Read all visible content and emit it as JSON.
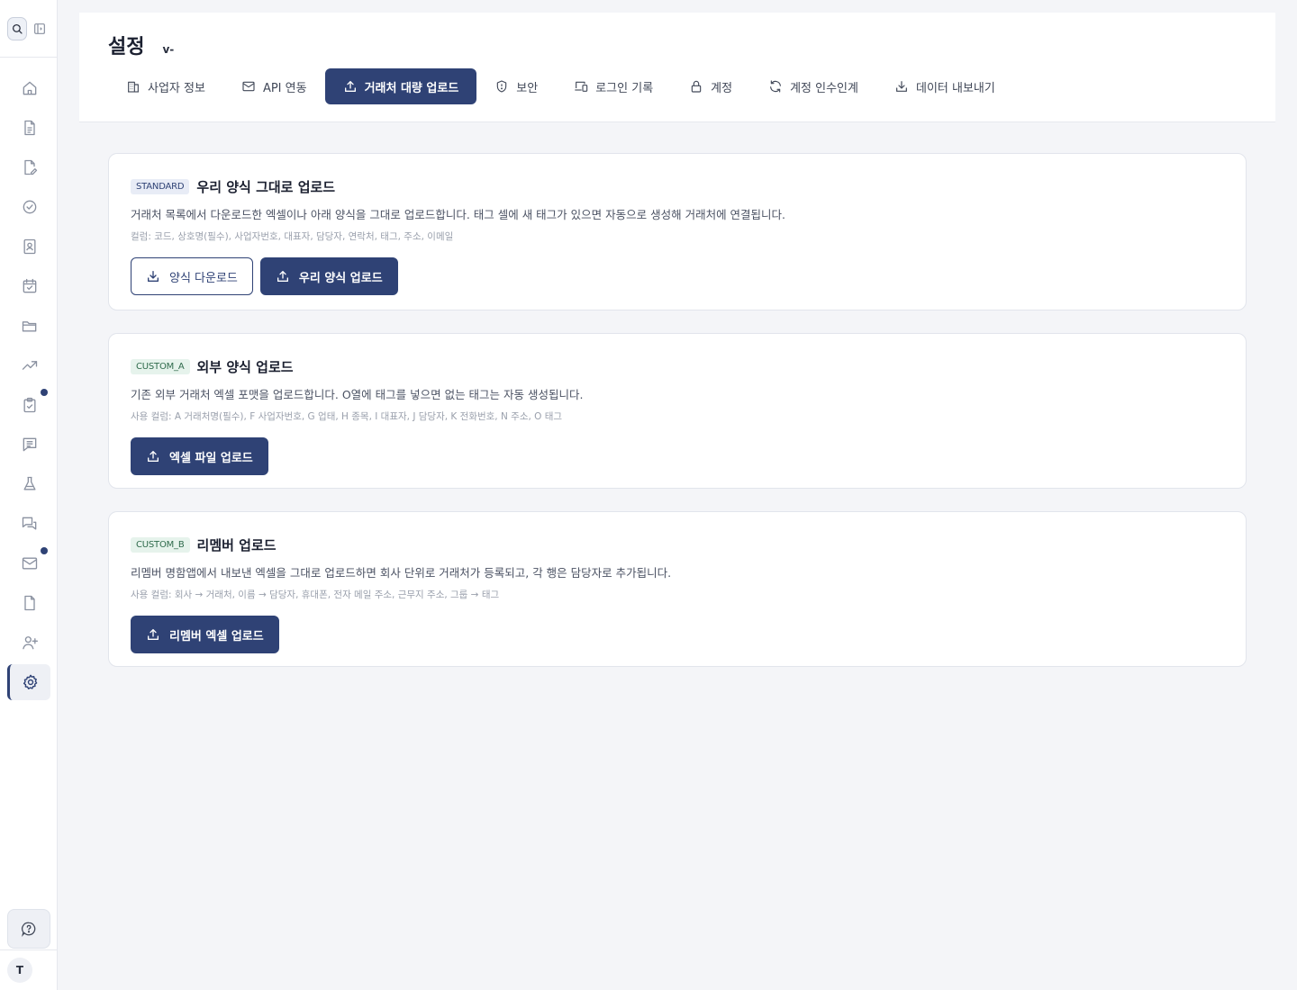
{
  "header": {
    "title": "설정",
    "version": "v-"
  },
  "tabs": [
    {
      "label": "사업자 정보",
      "icon": "building-icon"
    },
    {
      "label": "API 연동",
      "icon": "mail-icon"
    },
    {
      "label": "거래처 대량 업로드",
      "icon": "upload-icon",
      "active": true
    },
    {
      "label": "보안",
      "icon": "shield-icon"
    },
    {
      "label": "로그인 기록",
      "icon": "devices-icon"
    },
    {
      "label": "계정",
      "icon": "lock-icon"
    },
    {
      "label": "계정 인수인계",
      "icon": "refresh-icon"
    },
    {
      "label": "데이터 내보내기",
      "icon": "download-icon"
    }
  ],
  "cards": [
    {
      "badge": "STANDARD",
      "title": "우리 양식 그대로 업로드",
      "description": "거래처 목록에서 다운로드한 엑셀이나 아래 양식을 그대로 업로드합니다. 태그 셀에 새 태그가 있으면 자동으로 생성해 거래처에 연결됩니다.",
      "columns": "컬럼: 코드, 상호명(필수), 사업자번호, 대표자, 담당자, 연락처, 태그, 주소, 이메일",
      "buttons": [
        "양식 다운로드",
        "우리 양식 업로드"
      ]
    },
    {
      "badge": "CUSTOM_A",
      "title": "외부 양식 업로드",
      "description": "기존 외부 거래처 엑셀 포맷을 업로드합니다. O열에 태그를 넣으면 없는 태그는 자동 생성됩니다.",
      "columns": "사용 컬럼: A 거래처명(필수), F 사업자번호, G 업태, H 종목, I 대표자, J 담당자, K 전화번호, N 주소, O 태그",
      "buttons": [
        "엑셀 파일 업로드"
      ]
    },
    {
      "badge": "CUSTOM_B",
      "title": "리멤버 업로드",
      "description": "리멤버 명함앱에서 내보낸 엑셀을 그대로 업로드하면 회사 단위로 거래처가 등록되고, 각 행은 담당자로 추가됩니다.",
      "columns": "사용 컬럼: 회사 → 거래처, 이름 → 담당자, 휴대폰, 전자 메일 주소, 근무지 주소, 그룹 → 태그",
      "buttons": [
        "리멤버 엑셀 업로드"
      ]
    }
  ],
  "sidebar": {
    "items": [
      "home-icon",
      "document-icon",
      "edit-document-icon",
      "check-circle-icon",
      "contact-book-icon",
      "calendar-icon",
      "folder-icon",
      "trend-icon",
      "clipboard-check-icon",
      "message-icon",
      "flask-icon",
      "chat-icon",
      "mail-icon",
      "file-icon",
      "user-add-icon",
      "gear-icon"
    ],
    "avatar_initial": "T"
  },
  "colors": {
    "primary": "#2f4275",
    "badge_standard_bg": "#e8ecf6",
    "badge_custom_bg": "#e6f3ec"
  }
}
